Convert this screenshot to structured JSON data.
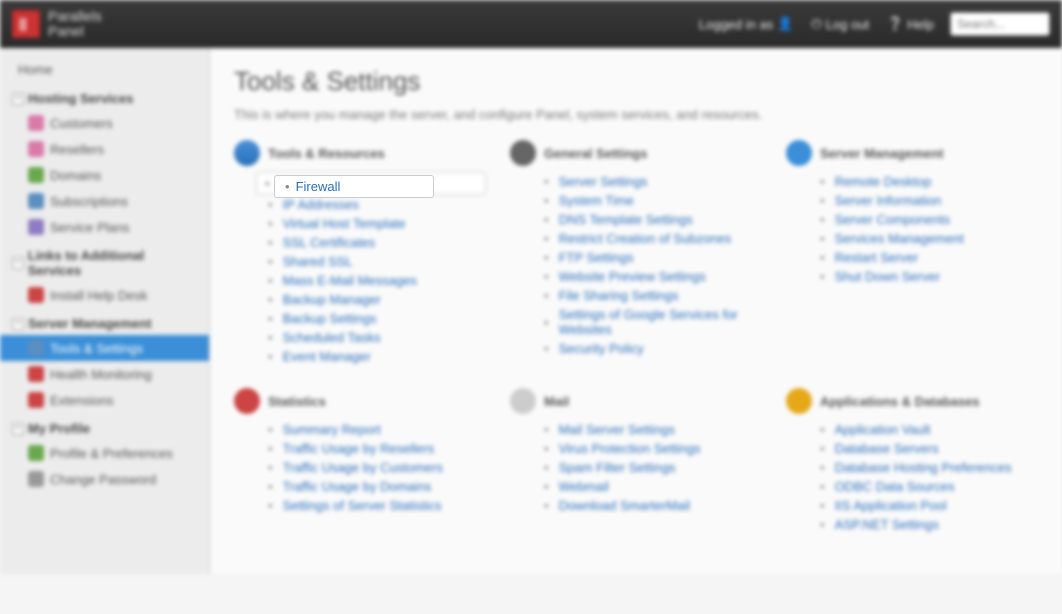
{
  "topbar": {
    "brand_line1": "Parallels",
    "brand_line2": "Panel",
    "logged_in_label": "Logged in as",
    "logout_label": "Log out",
    "help_label": "Help",
    "search_placeholder": "Search..."
  },
  "sidebar": {
    "home_label": "Home",
    "sections": [
      {
        "title": "Hosting Services",
        "items": [
          {
            "label": "Customers",
            "icon": "ic-user"
          },
          {
            "label": "Resellers",
            "icon": "ic-reseller"
          },
          {
            "label": "Domains",
            "icon": "ic-domain"
          },
          {
            "label": "Subscriptions",
            "icon": "ic-sub"
          },
          {
            "label": "Service Plans",
            "icon": "ic-plan"
          }
        ]
      },
      {
        "title": "Links to Additional Services",
        "items": [
          {
            "label": "Install Help Desk",
            "icon": "ic-red"
          }
        ]
      },
      {
        "title": "Server Management",
        "items": [
          {
            "label": "Tools & Settings",
            "icon": "ic-tools",
            "active": true
          },
          {
            "label": "Health Monitoring",
            "icon": "ic-health"
          },
          {
            "label": "Extensions",
            "icon": "ic-ext"
          }
        ]
      },
      {
        "title": "My Profile",
        "items": [
          {
            "label": "Profile & Preferences",
            "icon": "ic-profile"
          },
          {
            "label": "Change Password",
            "icon": "ic-pw"
          }
        ]
      }
    ]
  },
  "main": {
    "title": "Tools & Settings",
    "description": "This is where you manage the server, and configure Panel, system services, and resources.",
    "rows": [
      [
        {
          "title": "Tools & Resources",
          "icon": "gi-tools",
          "links": [
            {
              "label": "Firewall",
              "highlighted": true
            },
            {
              "label": "IP Addresses"
            },
            {
              "label": "Virtual Host Template"
            },
            {
              "label": "SSL Certificates"
            },
            {
              "label": "Shared SSL"
            },
            {
              "label": "Mass E-Mail Messages"
            },
            {
              "label": "Backup Manager"
            },
            {
              "label": "Backup Settings"
            },
            {
              "label": "Scheduled Tasks"
            },
            {
              "label": "Event Manager"
            }
          ]
        },
        {
          "title": "General Settings",
          "icon": "gi-general",
          "links": [
            {
              "label": "Server Settings"
            },
            {
              "label": "System Time"
            },
            {
              "label": "DNS Template Settings"
            },
            {
              "label": "Restrict Creation of Subzones"
            },
            {
              "label": "FTP Settings"
            },
            {
              "label": "Website Preview Settings"
            },
            {
              "label": "File Sharing Settings"
            },
            {
              "label": "Settings of Google Services for Websites"
            },
            {
              "label": "Security Policy"
            }
          ]
        },
        {
          "title": "Server Management",
          "icon": "gi-server",
          "links": [
            {
              "label": "Remote Desktop"
            },
            {
              "label": "Server Information"
            },
            {
              "label": "Server Components"
            },
            {
              "label": "Services Management"
            },
            {
              "label": "Restart Server"
            },
            {
              "label": "Shut Down Server"
            }
          ]
        }
      ],
      [
        {
          "title": "Statistics",
          "icon": "gi-stats",
          "links": [
            {
              "label": "Summary Report"
            },
            {
              "label": "Traffic Usage by Resellers"
            },
            {
              "label": "Traffic Usage by Customers"
            },
            {
              "label": "Traffic Usage by Domains"
            },
            {
              "label": "Settings of Server Statistics"
            }
          ]
        },
        {
          "title": "Mail",
          "icon": "gi-mail",
          "links": [
            {
              "label": "Mail Server Settings"
            },
            {
              "label": "Virus Protection Settings"
            },
            {
              "label": "Spam Filter Settings"
            },
            {
              "label": "Webmail"
            },
            {
              "label": "Download SmarterMail"
            }
          ]
        },
        {
          "title": "Applications & Databases",
          "icon": "gi-apps",
          "links": [
            {
              "label": "Application Vault"
            },
            {
              "label": "Database Servers"
            },
            {
              "label": "Database Hosting Preferences"
            },
            {
              "label": "ODBC Data Sources"
            },
            {
              "label": "IIS Application Pool"
            },
            {
              "label": "ASP.NET Settings"
            }
          ]
        }
      ]
    ]
  }
}
